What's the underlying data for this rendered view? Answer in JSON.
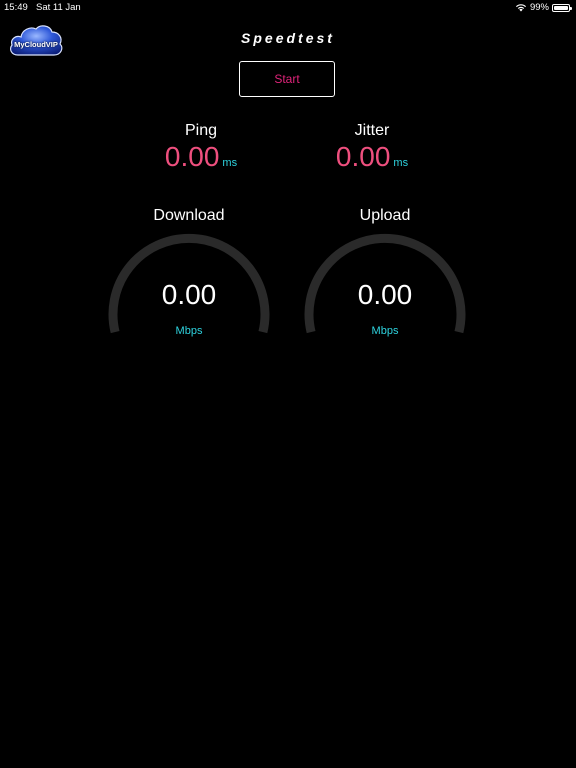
{
  "status_bar": {
    "time": "15:49",
    "date": "Sat 11 Jan",
    "battery": "99%",
    "battery_level": 0.99
  },
  "logo": {
    "text": "MyCloudVIP"
  },
  "title": "Speedtest",
  "start_button": {
    "label": "Start"
  },
  "ping": {
    "label": "Ping",
    "value": "0.00",
    "unit": "ms"
  },
  "jitter": {
    "label": "Jitter",
    "value": "0.00",
    "unit": "ms"
  },
  "download": {
    "label": "Download",
    "value": "0.00",
    "unit": "Mbps",
    "progress": 0
  },
  "upload": {
    "label": "Upload",
    "value": "0.00",
    "unit": "Mbps",
    "progress": 0
  },
  "colors": {
    "background": "#000000",
    "accent_pink": "#ee4f7e",
    "accent_cyan": "#2ed3df",
    "start_text": "#e0247a",
    "gauge_track": "#2a2a2a"
  }
}
